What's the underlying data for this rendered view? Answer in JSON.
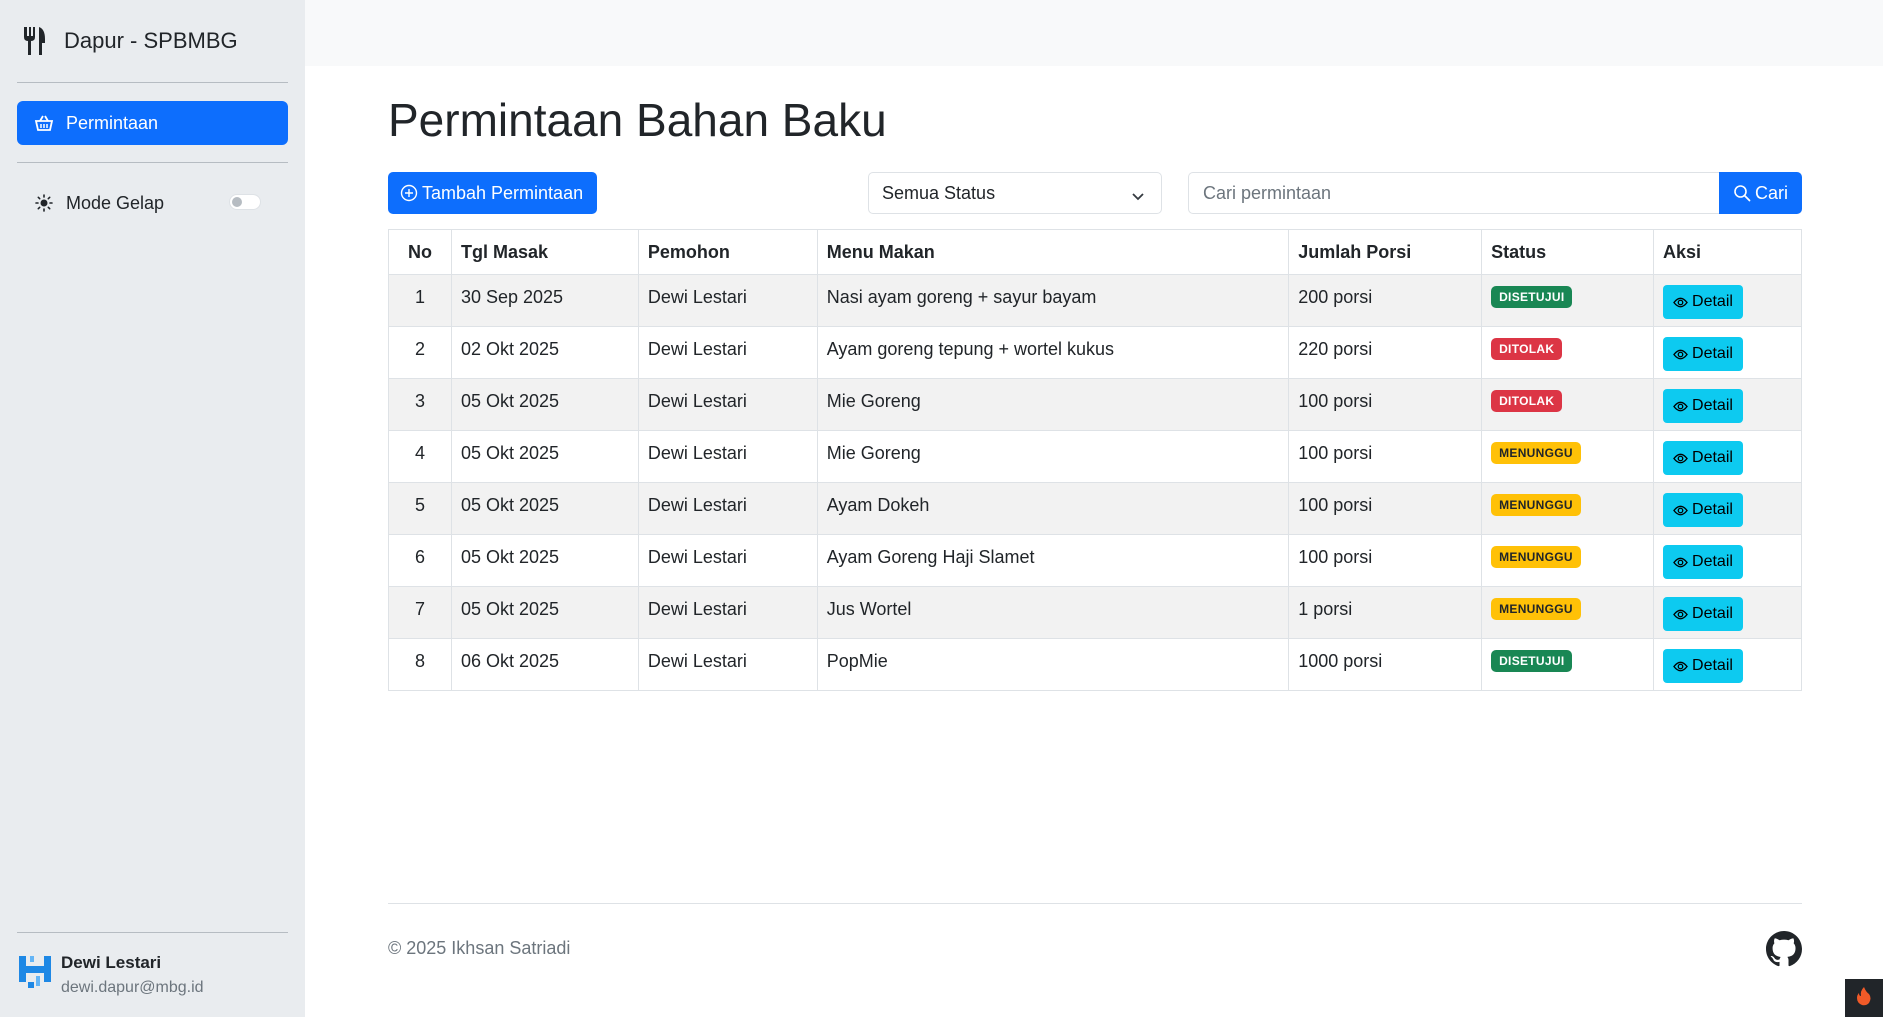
{
  "sidebar": {
    "brand": "Dapur - SPBMBG",
    "nav_active_label": "Permintaan",
    "mode_label": "Mode Gelap",
    "user_name": "Dewi Lestari",
    "user_email": "dewi.dapur@mbg.id"
  },
  "main": {
    "title": "Permintaan Bahan Baku",
    "add_button": "Tambah Permintaan",
    "status_filter": "Semua Status",
    "search_placeholder": "Cari permintaan",
    "search_button": "Cari"
  },
  "table": {
    "headers": [
      "No",
      "Tgl Masak",
      "Pemohon",
      "Menu Makan",
      "Jumlah Porsi",
      "Status",
      "Aksi"
    ],
    "detail_label": "Detail",
    "rows": [
      {
        "no": "1",
        "tgl": "30 Sep 2025",
        "pemohon": "Dewi Lestari",
        "menu": "Nasi ayam goreng + sayur bayam",
        "porsi": "200 porsi",
        "status": "DISETUJUI"
      },
      {
        "no": "2",
        "tgl": "02 Okt 2025",
        "pemohon": "Dewi Lestari",
        "menu": "Ayam goreng tepung + wortel kukus",
        "porsi": "220 porsi",
        "status": "DITOLAK"
      },
      {
        "no": "3",
        "tgl": "05 Okt 2025",
        "pemohon": "Dewi Lestari",
        "menu": "Mie Goreng",
        "porsi": "100 porsi",
        "status": "DITOLAK"
      },
      {
        "no": "4",
        "tgl": "05 Okt 2025",
        "pemohon": "Dewi Lestari",
        "menu": "Mie Goreng",
        "porsi": "100 porsi",
        "status": "MENUNGGU"
      },
      {
        "no": "5",
        "tgl": "05 Okt 2025",
        "pemohon": "Dewi Lestari",
        "menu": "Ayam Dokeh",
        "porsi": "100 porsi",
        "status": "MENUNGGU"
      },
      {
        "no": "6",
        "tgl": "05 Okt 2025",
        "pemohon": "Dewi Lestari",
        "menu": "Ayam Goreng Haji Slamet",
        "porsi": "100 porsi",
        "status": "MENUNGGU"
      },
      {
        "no": "7",
        "tgl": "05 Okt 2025",
        "pemohon": "Dewi Lestari",
        "menu": "Jus Wortel",
        "porsi": "1 porsi",
        "status": "MENUNGGU"
      },
      {
        "no": "8",
        "tgl": "06 Okt 2025",
        "pemohon": "Dewi Lestari",
        "menu": "PopMie",
        "porsi": "1000 porsi",
        "status": "DISETUJUI"
      }
    ]
  },
  "footer": {
    "copyright": "© 2025 Ikhsan Satriadi"
  },
  "icons": {
    "brand": "utensils-icon",
    "nav": "basket-icon",
    "mode": "sun-icon",
    "add": "plus-circle-icon",
    "search": "search-icon",
    "detail": "eye-icon",
    "footer": "github-icon"
  },
  "colors": {
    "primary": "#0d6efd",
    "info": "#0dcaf0",
    "success": "#198754",
    "danger": "#dc3545",
    "warning": "#ffc107"
  }
}
